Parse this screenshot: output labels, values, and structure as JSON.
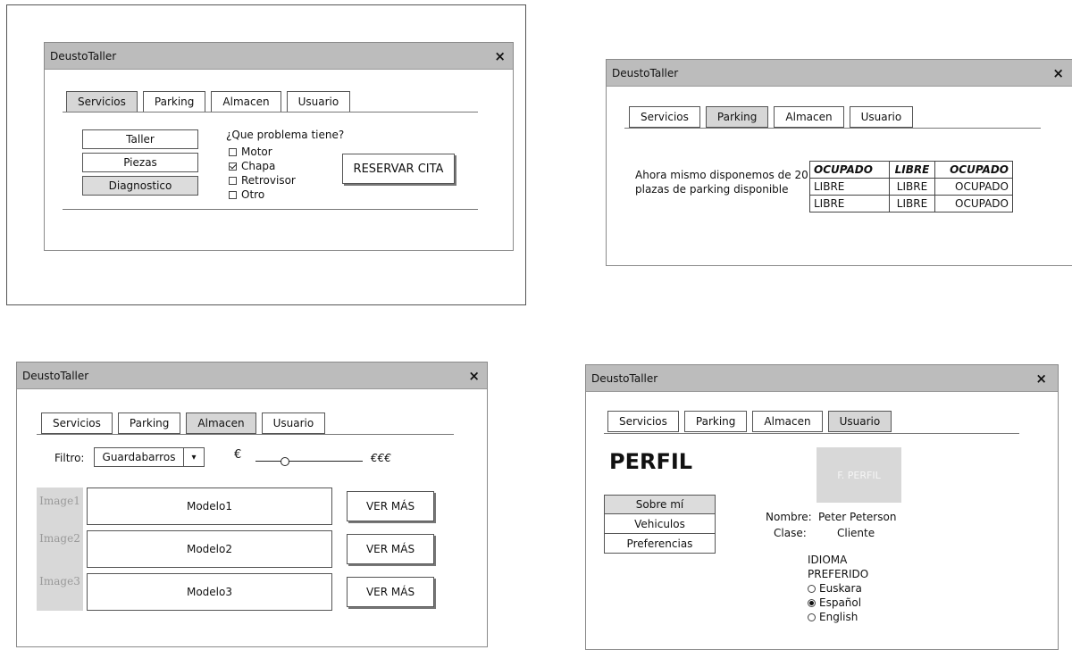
{
  "app_title": "DeustoTaller",
  "close_glyph": "×",
  "tabs": [
    "Servicios",
    "Parking",
    "Almacen",
    "Usuario"
  ],
  "servicios": {
    "menu": [
      "Taller",
      "Piezas",
      "Diagnostico"
    ],
    "question": "¿Que problema tiene?",
    "options": [
      {
        "label": "Motor",
        "checked": false
      },
      {
        "label": "Chapa",
        "checked": true
      },
      {
        "label": "Retrovisor",
        "checked": false
      },
      {
        "label": "Otro",
        "checked": false
      }
    ],
    "reserve_button": "RESERVAR CITA"
  },
  "parking": {
    "info_line1": "Ahora mismo disponemos de 20",
    "info_line2": "plazas de parking disponible",
    "table": [
      [
        "OCUPADO",
        "LIBRE",
        "OCUPADO"
      ],
      [
        "LIBRE",
        "LIBRE",
        "OCUPADO"
      ],
      [
        "LIBRE",
        "LIBRE",
        "OCUPADO"
      ]
    ]
  },
  "almacen": {
    "filter_label": "Filtro:",
    "filter_value": "Guardabarros",
    "dropdown_glyph": "▾",
    "price_min": "€",
    "price_max": "€€€",
    "slider_value": 0.25,
    "items": [
      {
        "image": "Image1",
        "model": "Modelo1",
        "button": "VER MÁS"
      },
      {
        "image": "Image2",
        "model": "Modelo2",
        "button": "VER MÁS"
      },
      {
        "image": "Image3",
        "model": "Modelo3",
        "button": "VER MÁS"
      }
    ]
  },
  "usuario": {
    "heading": "PERFIL",
    "photo_label": "F. PERFIL",
    "menu": [
      "Sobre mí",
      "Vehiculos",
      "Preferencias"
    ],
    "name_label": "Nombre:",
    "name_value": "Peter Peterson",
    "class_label": "Clase:",
    "class_value": "Cliente",
    "language_title_line1": "IDIOMA",
    "language_title_line2": "PREFERIDO",
    "languages": [
      {
        "label": "Euskara",
        "selected": false
      },
      {
        "label": "Español",
        "selected": true
      },
      {
        "label": "English",
        "selected": false
      }
    ]
  }
}
